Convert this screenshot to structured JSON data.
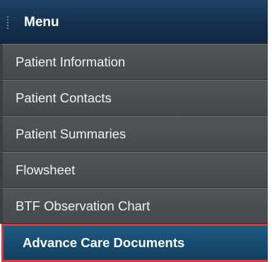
{
  "menu": {
    "title": "Menu",
    "items": [
      {
        "label": "Patient Information",
        "active": false
      },
      {
        "label": "Patient Contacts",
        "active": false
      },
      {
        "label": "Patient Summaries",
        "active": false
      },
      {
        "label": "Flowsheet",
        "active": false
      },
      {
        "label": "BTF Observation Chart",
        "active": false
      },
      {
        "label": "Advance Care Documents",
        "active": true
      }
    ]
  },
  "colors": {
    "header_bg": "#15314f",
    "item_bg": "#4a4f53",
    "active_bg": "#164d72",
    "highlight_border": "#d23a3f"
  }
}
